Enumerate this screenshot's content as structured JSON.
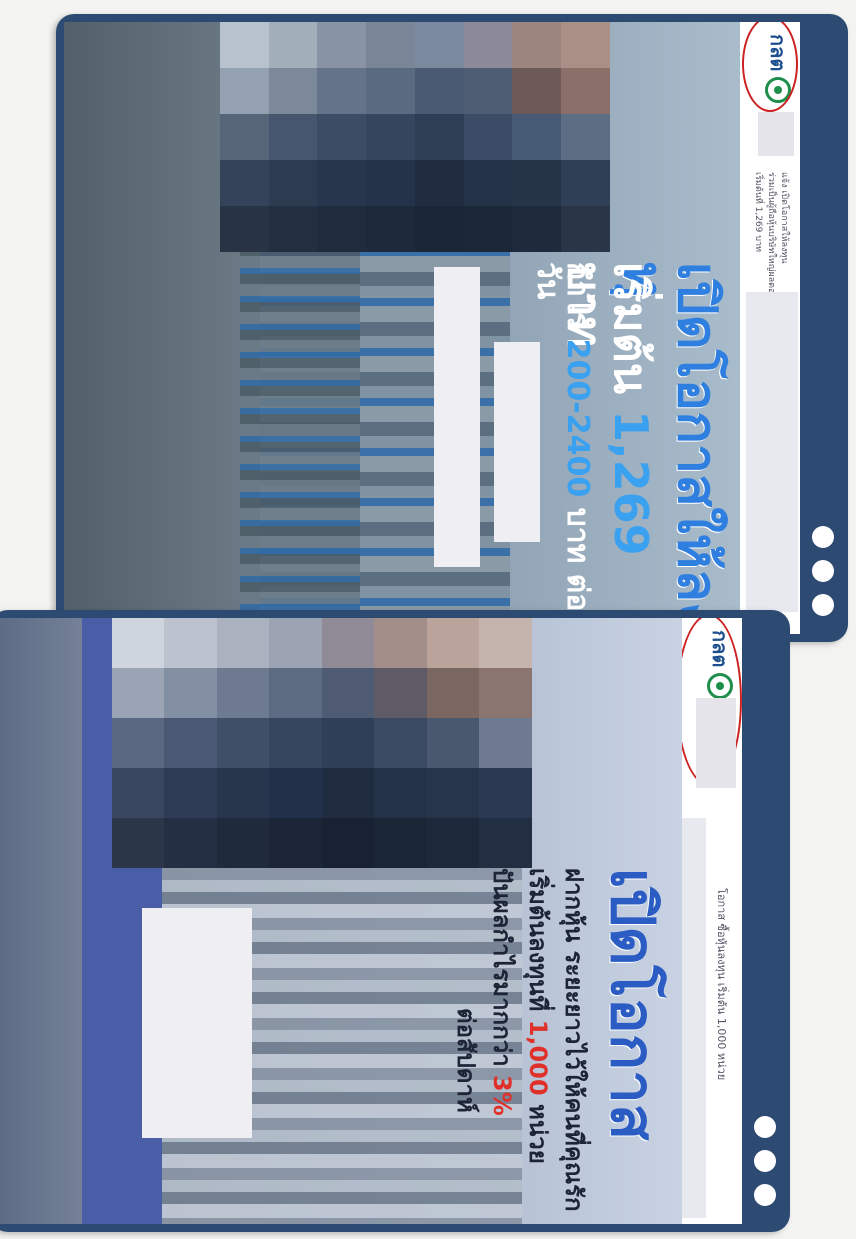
{
  "post1": {
    "logo_text": "กลต",
    "caption_lines": [
      "แจ้ง เปิดโอกาสให้ลงทุน",
      "ร่วมเป็นผู้ถือหุ้นบริษัทใหญ่ผลตอบแทนรายวันได้แน่ๆ",
      "เริ่มต้นที่ 1,269 บาท"
    ],
    "headline": "เปิดโอกาสให้ลงทุ",
    "subhead_prefix": "เริ่มต้น ",
    "subhead_amount": "1,269",
    "subhead_suffix": " บาท",
    "profit_prefix": "กำไร ",
    "profit_range": "200-2400",
    "profit_suffix": " บาท ต่อวัน"
  },
  "post2": {
    "logo_text": "กลต",
    "caption_line": "โอกาส ซื้อหุ้นลงทุน เริ่มต้น 1,000 หน่วย",
    "headline": "เปิดโอกาส",
    "line1": "ฝากหุ้น ระยะยาวไว้ให้คนที่คุณรัก",
    "line2_prefix": "เริ่มต้นลงทุนที่ ",
    "line2_amount": "1,000",
    "line2_suffix": " หน่วย",
    "line3_prefix": "ปันผลกำไรมากกว่า ",
    "line3_amount": "3%",
    "line4": "ต่อสัปดาห์"
  },
  "colors": {
    "frame": "#2d4a72",
    "headline_blue": "#2f7fe0",
    "highlight_red": "#e0302a",
    "annotation_red": "#c22222"
  }
}
